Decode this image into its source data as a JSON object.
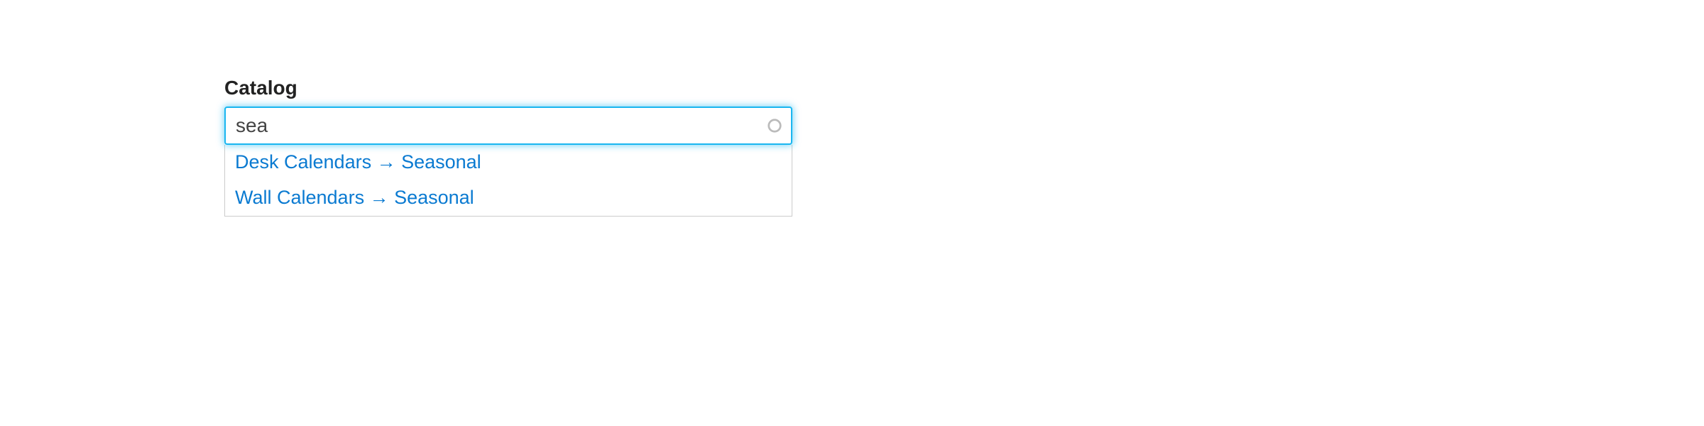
{
  "field": {
    "label": "Catalog",
    "value": "sea"
  },
  "suggestions": [
    "Desk Calendars → Seasonal",
    "Wall Calendars → Seasonal"
  ]
}
